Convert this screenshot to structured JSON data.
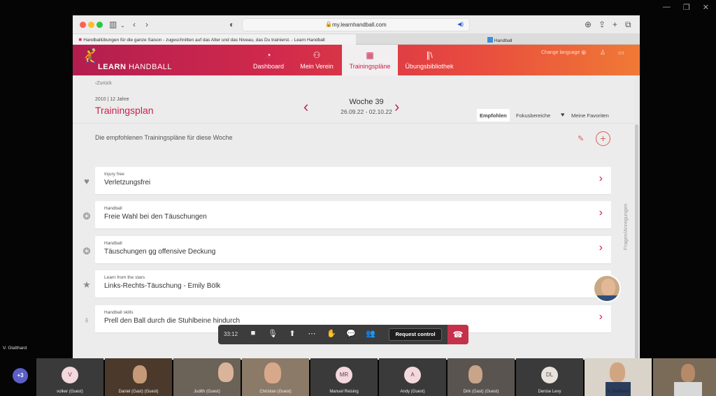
{
  "browser": {
    "url": "my.learnhandball.com",
    "tabs": [
      {
        "label": "Handballübungen für die ganze Saison - zugeschnitten auf das Alter und das Niveau, das Du trainierst. - Learn Handball"
      },
      {
        "label": "Handball"
      }
    ]
  },
  "header": {
    "logo_bold": "LEARN",
    "logo_light": "HANDBALL",
    "nav": [
      {
        "label": "Dashboard",
        "icon": "gauge-icon"
      },
      {
        "label": "Mein Verein",
        "icon": "team-icon"
      },
      {
        "label": "Trainingspläne",
        "icon": "calendar-icon"
      },
      {
        "label": "Übungsbibliothek",
        "icon": "library-icon"
      }
    ],
    "change_language": "Change language"
  },
  "page": {
    "back": "Zurück",
    "meta": "2010 | 12 Jahre",
    "title": "Trainingsplan",
    "week": "Woche 39",
    "dates": "26.09.22 - 02.10.22",
    "segments": [
      "Empfohlen",
      "Fokusbereiche",
      "Meine Favoriten"
    ],
    "intro": "Die empfohlenen Trainingspläne für diese Woche",
    "feedback": "Fragen/Anregungen"
  },
  "cards": [
    {
      "category": "Injury free",
      "title": "Verletzungsfrei",
      "icon": "heart-pulse-icon"
    },
    {
      "category": "Handball",
      "title": "Freie Wahl bei den Täuschungen",
      "icon": "handball-icon"
    },
    {
      "category": "Handball",
      "title": "Täuschungen gg offensive Deckung",
      "icon": "handball-icon"
    },
    {
      "category": "Learn from the stars",
      "title": "Links-Rechts-Täuschung - Emily Bölk",
      "icon": "star-icon"
    },
    {
      "category": "Handball skills",
      "title": "Prell den Ball durch die Stuhlbeine hindurch",
      "icon": "medal-icon"
    }
  ],
  "call": {
    "timer": "33:12",
    "request_control": "Request control",
    "self_name": "V. Glatthard",
    "overflow": "+3",
    "participants": [
      {
        "name": "volker (Guest)",
        "initials": "V"
      },
      {
        "name": "Daniel (Gast) (Guest)",
        "initials": ""
      },
      {
        "name": "Judith (Guest)",
        "initials": ""
      },
      {
        "name": "Christian (Guest)",
        "initials": ""
      },
      {
        "name": "Manuel Reising",
        "initials": "MR"
      },
      {
        "name": "Andy (Guest)",
        "initials": "A"
      },
      {
        "name": "Dirk (Gast) (Guest)",
        "initials": ""
      },
      {
        "name": "Denise Levy",
        "initials": "DL"
      },
      {
        "name": "V. Glatthard",
        "initials": ""
      },
      {
        "name": "",
        "initials": ""
      }
    ]
  },
  "colors": {
    "brand": "#c8214d",
    "accent_orange": "#f07a35",
    "teams_purple": "#5b5fc7",
    "hangup": "#c4314b"
  }
}
